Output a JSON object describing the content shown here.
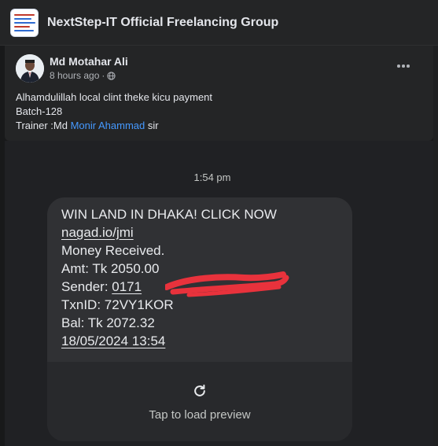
{
  "group": {
    "name": "NextStep-IT Official Freelancing Group"
  },
  "post": {
    "author": "Md Motahar Ali",
    "time": "8 hours ago",
    "separator": "·",
    "privacy_icon": "globe-icon",
    "more_icon": "more-horizontal-icon",
    "line1": "Alhamdulillah local clint theke kicu payment",
    "line2": "Batch-128",
    "line3_prefix": "Trainer :Md ",
    "line3_link": "Monir Ahammad",
    "line3_suffix": " sir"
  },
  "sms": {
    "timestamp": "1:54 pm",
    "lines": [
      "WIN LAND IN DHAKA! CLICK NOW",
      "nagad.io/jmi",
      "Money Received.",
      "Amt: Tk 2050.00",
      "Sender: 0171",
      "TxnID: 72VY1KOR",
      "Bal: Tk 2072.32",
      "18/05/2024 13:54"
    ],
    "preview_label": "Tap to load preview",
    "refresh_icon": "refresh-icon"
  },
  "colors": {
    "background": "#18191a",
    "card": "#242526",
    "bubble": "#303134",
    "link": "#4599ff",
    "redaction": "#e8323c"
  }
}
